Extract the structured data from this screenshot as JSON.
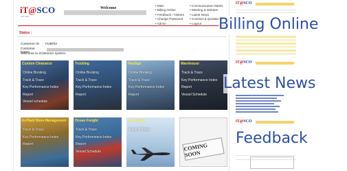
{
  "brand": {
    "logo_it": "iT@",
    "logo_sco": "SCO",
    "logo_sub": "ISO 9001"
  },
  "header": {
    "welcome": "Welcome",
    "menu_left": [
      "Main",
      "Billing Online",
      "Feedback / Visitors",
      "Change Password",
      "Admin"
    ],
    "menu_right": [
      "Communication Matrix",
      "Meeting & Minutes",
      "Latest News",
      "Contract & Quotation",
      "Logout"
    ]
  },
  "status_label": "Status :",
  "customer": {
    "id_label": "Customer ID",
    "id_value": "HUB/03",
    "name_label": "Customer Name",
    "welcome_text": "Welcome to iCustomer system."
  },
  "tiles": [
    {
      "title": "Custom Clearance",
      "items": [
        "Online Booking",
        "Track & Trace",
        "Key Performance Index",
        "Report",
        "Vessel schedule"
      ]
    },
    {
      "title": "Trucking",
      "items": [
        "Online Booking",
        "Track & Trace",
        "Key Performance Index",
        "Report"
      ]
    },
    {
      "title": "Haulage",
      "items": [
        "Online Booking",
        "Track & Trace",
        "Key Performance Index",
        "Report"
      ]
    },
    {
      "title": "Warehouse",
      "items": [
        "Track & Trace",
        "Key Performance Index",
        "Report",
        "Vessel Schedule"
      ]
    },
    {
      "title": "In-Plant Store Management",
      "items": [
        "Track & Trace",
        "Key Performance Index",
        "Report"
      ]
    },
    {
      "title": "Ocean Freight",
      "items": [
        "Track & Trace",
        "Key Performance Index",
        "Report",
        "Vessel Schedule"
      ]
    },
    {
      "title": "Air Freight",
      "items": [
        "Track & Trace"
      ]
    },
    {
      "title": "",
      "items": [],
      "badge": "COMING SOON"
    }
  ],
  "overlays": {
    "billing": "Billing Online",
    "news": "Latest News",
    "feedback": "Feedback"
  },
  "colors": {
    "brand_red": "#c8191e",
    "brand_blue": "#1b3f8f",
    "tile_title": "#ffe33b",
    "overlay_text": "#2b4fa8"
  }
}
